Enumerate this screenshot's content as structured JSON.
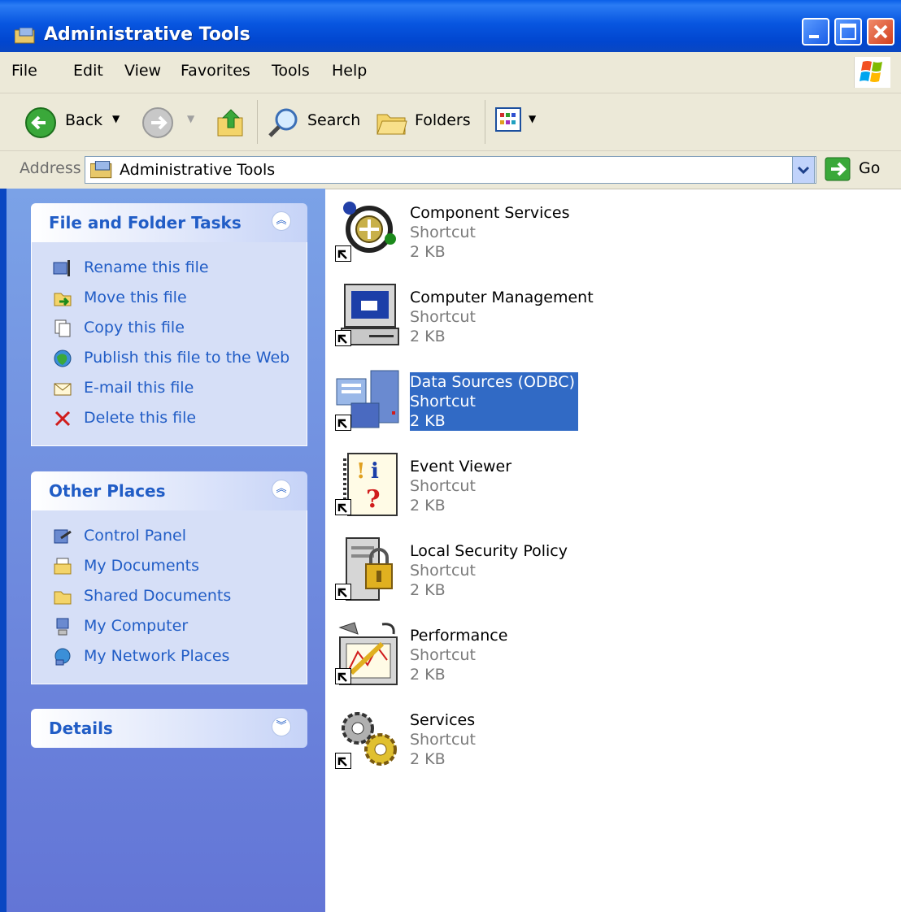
{
  "window": {
    "title": "Administrative Tools"
  },
  "menu": {
    "items": [
      "File",
      "Edit",
      "View",
      "Favorites",
      "Tools",
      "Help"
    ]
  },
  "toolbar": {
    "back_label": "Back",
    "search_label": "Search",
    "folders_label": "Folders"
  },
  "address": {
    "label": "Address",
    "value": "Administrative Tools",
    "go_label": "Go"
  },
  "panels": {
    "file_tasks": {
      "title": "File and Folder Tasks",
      "items": [
        {
          "label": "Rename this file",
          "icon": "rename-icon"
        },
        {
          "label": "Move this file",
          "icon": "move-icon"
        },
        {
          "label": "Copy this file",
          "icon": "copy-icon"
        },
        {
          "label": "Publish this file to the Web",
          "icon": "publish-web-icon"
        },
        {
          "label": "E-mail this file",
          "icon": "email-icon"
        },
        {
          "label": "Delete this file",
          "icon": "delete-icon"
        }
      ]
    },
    "other_places": {
      "title": "Other Places",
      "items": [
        {
          "label": "Control Panel",
          "icon": "control-panel-icon"
        },
        {
          "label": "My Documents",
          "icon": "my-documents-icon"
        },
        {
          "label": "Shared Documents",
          "icon": "folder-icon"
        },
        {
          "label": "My Computer",
          "icon": "my-computer-icon"
        },
        {
          "label": "My Network Places",
          "icon": "network-places-icon"
        }
      ]
    },
    "details": {
      "title": "Details"
    }
  },
  "files": [
    {
      "name": "Component Services",
      "type": "Shortcut",
      "size": "2 KB",
      "icon": "component-services-icon",
      "selected": false
    },
    {
      "name": "Computer Management",
      "type": "Shortcut",
      "size": "2 KB",
      "icon": "computer-management-icon",
      "selected": false
    },
    {
      "name": "Data Sources (ODBC)",
      "type": "Shortcut",
      "size": "2 KB",
      "icon": "data-sources-icon",
      "selected": true
    },
    {
      "name": "Event Viewer",
      "type": "Shortcut",
      "size": "2 KB",
      "icon": "event-viewer-icon",
      "selected": false
    },
    {
      "name": "Local Security Policy",
      "type": "Shortcut",
      "size": "2 KB",
      "icon": "security-policy-icon",
      "selected": false
    },
    {
      "name": "Performance",
      "type": "Shortcut",
      "size": "2 KB",
      "icon": "performance-icon",
      "selected": false
    },
    {
      "name": "Services",
      "type": "Shortcut",
      "size": "2 KB",
      "icon": "services-icon",
      "selected": false
    }
  ],
  "colors": {
    "titlebar": "#0a5fe8",
    "task_link": "#215dc6",
    "selection": "#316ac5"
  }
}
